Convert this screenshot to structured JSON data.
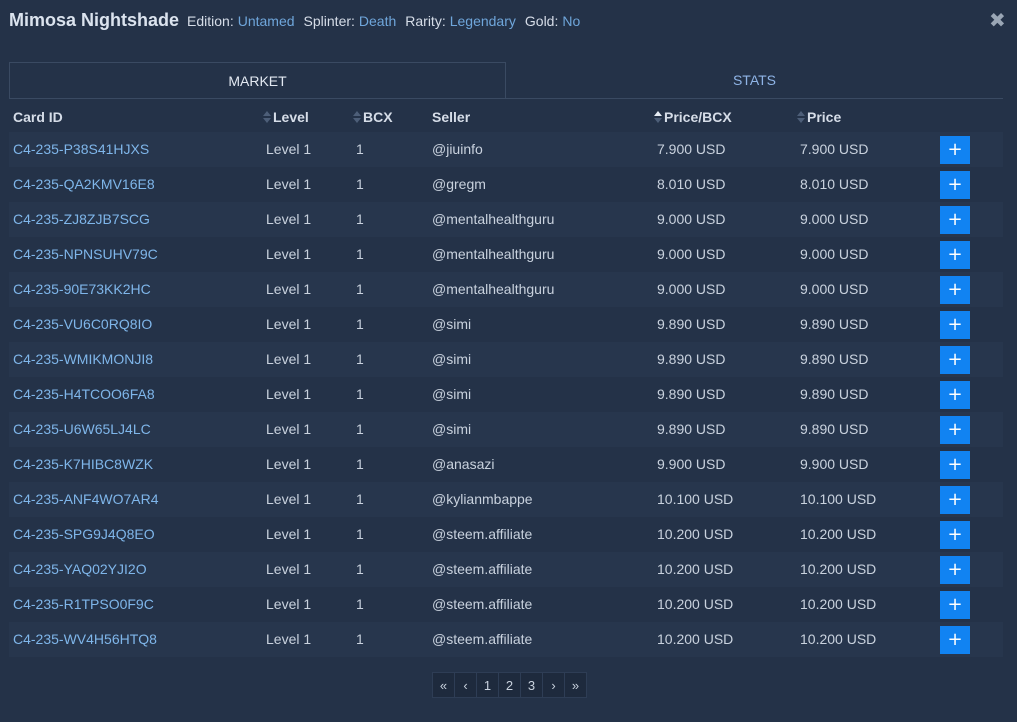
{
  "card": {
    "name": "Mimosa Nightshade",
    "edition_label": "Edition:",
    "edition": "Untamed",
    "splinter_label": "Splinter:",
    "splinter": "Death",
    "rarity_label": "Rarity:",
    "rarity": "Legendary",
    "gold_label": "Gold:",
    "gold": "No"
  },
  "tabs": [
    {
      "label": "MARKET",
      "active": true
    },
    {
      "label": "STATS",
      "active": false
    }
  ],
  "columns": {
    "card_id": "Card ID",
    "level": "Level",
    "bcx": "BCX",
    "seller": "Seller",
    "price_bcx": "Price/BCX",
    "price": "Price"
  },
  "add_label": "+",
  "rows": [
    {
      "id": "C4-235-P38S41HJXS",
      "level": "Level 1",
      "bcx": "1",
      "seller": "@jiuinfo",
      "price_bcx": "7.900 USD",
      "price": "7.900 USD"
    },
    {
      "id": "C4-235-QA2KMV16E8",
      "level": "Level 1",
      "bcx": "1",
      "seller": "@gregm",
      "price_bcx": "8.010 USD",
      "price": "8.010 USD"
    },
    {
      "id": "C4-235-ZJ8ZJB7SCG",
      "level": "Level 1",
      "bcx": "1",
      "seller": "@mentalhealthguru",
      "price_bcx": "9.000 USD",
      "price": "9.000 USD"
    },
    {
      "id": "C4-235-NPNSUHV79C",
      "level": "Level 1",
      "bcx": "1",
      "seller": "@mentalhealthguru",
      "price_bcx": "9.000 USD",
      "price": "9.000 USD"
    },
    {
      "id": "C4-235-90E73KK2HC",
      "level": "Level 1",
      "bcx": "1",
      "seller": "@mentalhealthguru",
      "price_bcx": "9.000 USD",
      "price": "9.000 USD"
    },
    {
      "id": "C4-235-VU6C0RQ8IO",
      "level": "Level 1",
      "bcx": "1",
      "seller": "@simi",
      "price_bcx": "9.890 USD",
      "price": "9.890 USD"
    },
    {
      "id": "C4-235-WMIKMONJI8",
      "level": "Level 1",
      "bcx": "1",
      "seller": "@simi",
      "price_bcx": "9.890 USD",
      "price": "9.890 USD"
    },
    {
      "id": "C4-235-H4TCOO6FA8",
      "level": "Level 1",
      "bcx": "1",
      "seller": "@simi",
      "price_bcx": "9.890 USD",
      "price": "9.890 USD"
    },
    {
      "id": "C4-235-U6W65LJ4LC",
      "level": "Level 1",
      "bcx": "1",
      "seller": "@simi",
      "price_bcx": "9.890 USD",
      "price": "9.890 USD"
    },
    {
      "id": "C4-235-K7HIBC8WZK",
      "level": "Level 1",
      "bcx": "1",
      "seller": "@anasazi",
      "price_bcx": "9.900 USD",
      "price": "9.900 USD"
    },
    {
      "id": "C4-235-ANF4WO7AR4",
      "level": "Level 1",
      "bcx": "1",
      "seller": "@kylianmbappe",
      "price_bcx": "10.100 USD",
      "price": "10.100 USD"
    },
    {
      "id": "C4-235-SPG9J4Q8EO",
      "level": "Level 1",
      "bcx": "1",
      "seller": "@steem.affiliate",
      "price_bcx": "10.200 USD",
      "price": "10.200 USD"
    },
    {
      "id": "C4-235-YAQ02YJI2O",
      "level": "Level 1",
      "bcx": "1",
      "seller": "@steem.affiliate",
      "price_bcx": "10.200 USD",
      "price": "10.200 USD"
    },
    {
      "id": "C4-235-R1TPSO0F9C",
      "level": "Level 1",
      "bcx": "1",
      "seller": "@steem.affiliate",
      "price_bcx": "10.200 USD",
      "price": "10.200 USD"
    },
    {
      "id": "C4-235-WV4H56HTQ8",
      "level": "Level 1",
      "bcx": "1",
      "seller": "@steem.affiliate",
      "price_bcx": "10.200 USD",
      "price": "10.200 USD"
    }
  ],
  "pagination": {
    "first": "«",
    "prev": "‹",
    "pages": [
      "1",
      "2",
      "3"
    ],
    "next": "›",
    "last": "»"
  },
  "colors": {
    "accent": "#1183f2",
    "link": "#7fb6ea",
    "background": "#243248"
  },
  "icons": {
    "close": "close-icon",
    "sort": "sort-icon"
  }
}
